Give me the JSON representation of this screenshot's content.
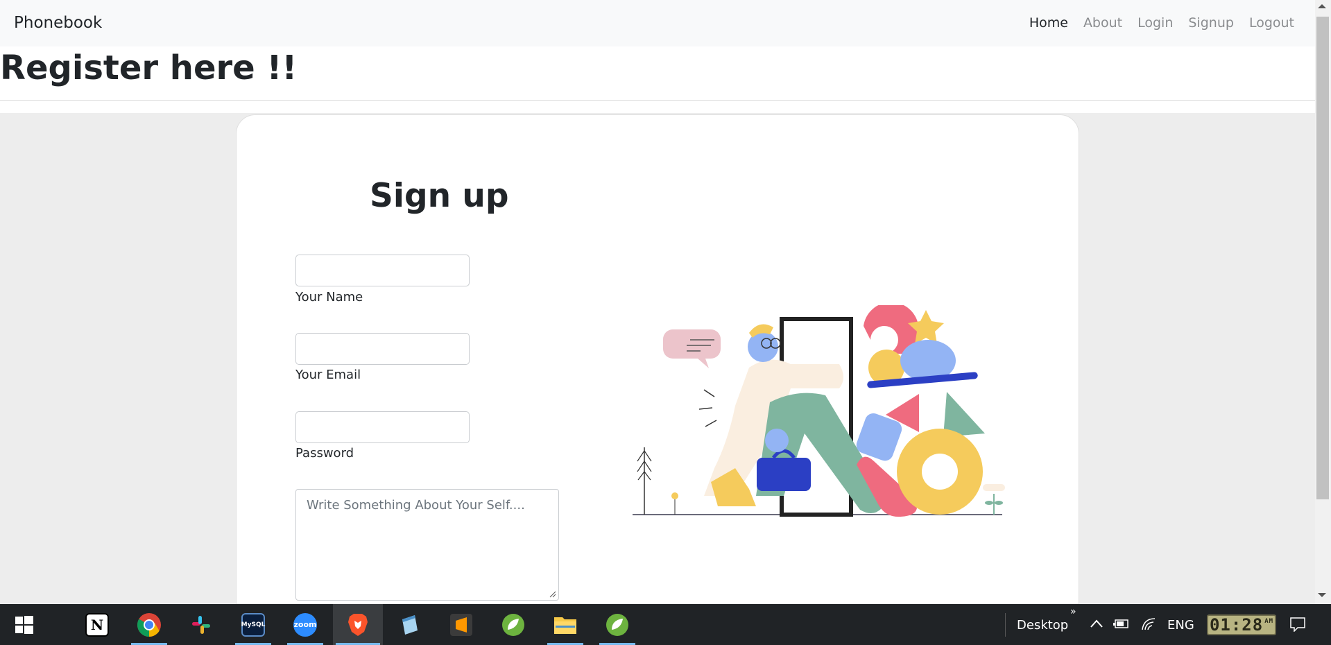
{
  "navbar": {
    "brand": "Phonebook",
    "links": [
      {
        "label": "Home",
        "active": true
      },
      {
        "label": "About",
        "active": false
      },
      {
        "label": "Login",
        "active": false
      },
      {
        "label": "Signup",
        "active": false
      },
      {
        "label": "Logout",
        "active": false
      }
    ]
  },
  "page": {
    "title": "Register here !!"
  },
  "form": {
    "title": "Sign up",
    "name_label": "Your Name",
    "name_value": "",
    "email_label": "Your Email",
    "email_value": "",
    "password_label": "Password",
    "password_value": "",
    "about_placeholder": "Write Something About Your Self...."
  },
  "taskbar": {
    "apps": [
      "start-icon",
      "notion-icon",
      "chrome-icon",
      "slack-icon",
      "mysql-icon",
      "zoom-icon",
      "brave-icon",
      "notepad-icon",
      "sublime-icon",
      "spring-icon",
      "file-explorer-icon",
      "spring-icon"
    ],
    "notion_label": "N",
    "zoom_label": "zoom",
    "mysql_label": "MySQL",
    "desktop_label": "Desktop",
    "chevron": "»",
    "language": "ENG",
    "clock": "01:28",
    "clock_suffix": "AM"
  },
  "colors": {
    "navbar_bg": "#f8f9fa",
    "page_bg": "#ededed",
    "card_bg": "#ffffff",
    "taskbar_bg": "#202326",
    "illustration_green": "#7fb59f",
    "illustration_yellow": "#f5cb5c",
    "illustration_pink": "#ef6b7f",
    "illustration_blue": "#93b4f4"
  }
}
